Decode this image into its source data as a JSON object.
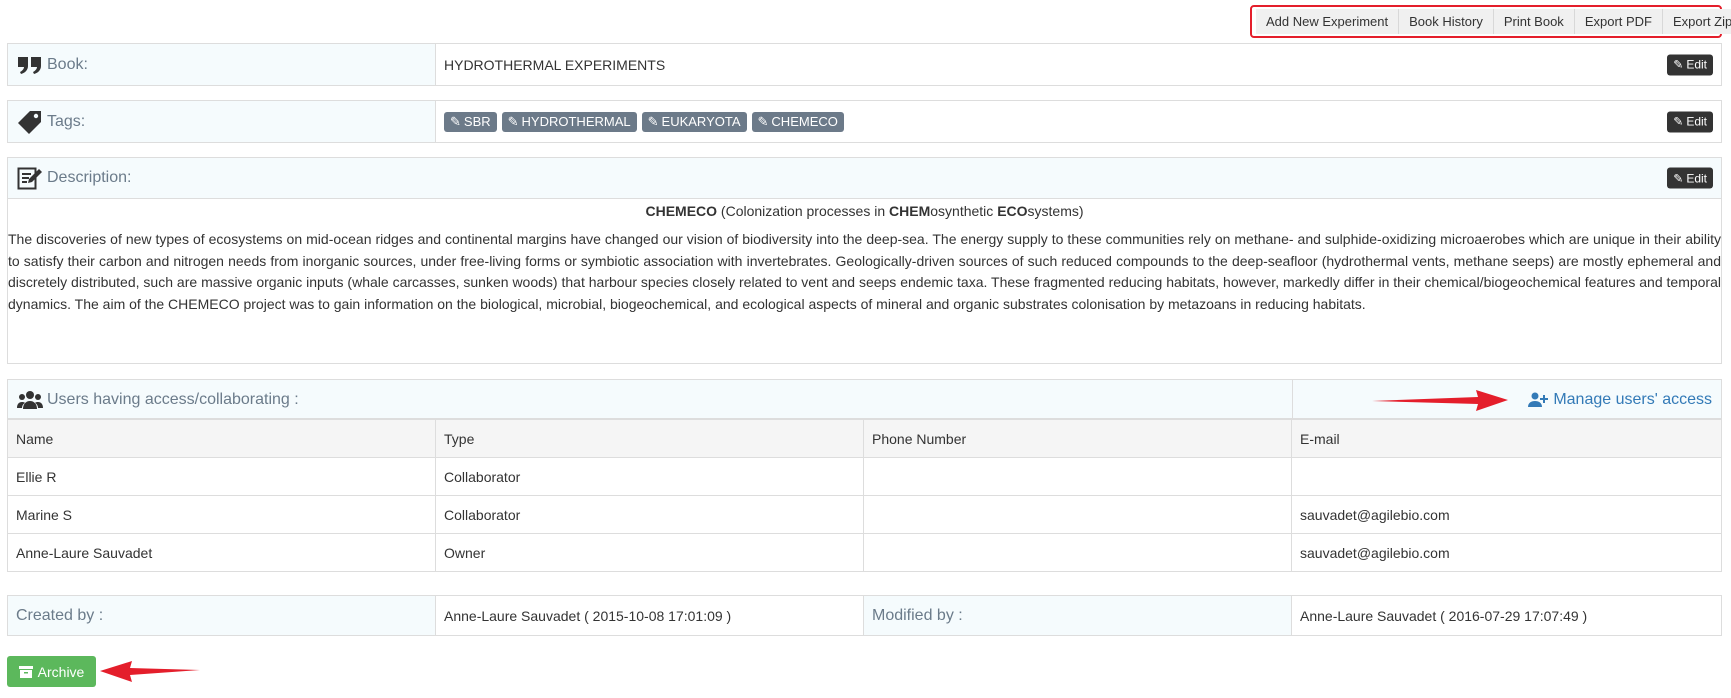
{
  "toolbar": {
    "buttons": [
      "Add New Experiment",
      "Book History",
      "Print Book",
      "Export PDF",
      "Export Zip"
    ]
  },
  "book": {
    "label": "Book:",
    "value": "HYDROTHERMAL EXPERIMENTS",
    "edit": "Edit"
  },
  "tags": {
    "label": "Tags:",
    "items": [
      "SBR",
      "HYDROTHERMAL",
      "EUKARYOTA",
      "CHEMECO"
    ],
    "edit": "Edit"
  },
  "description": {
    "label": "Description:",
    "edit": "Edit",
    "title_parts": [
      "CHEMECO",
      " (Colonization processes in ",
      "CHEM",
      "osynthetic ",
      "ECO",
      "systems)"
    ],
    "text": "The discoveries of new types of ecosystems on mid-ocean ridges and continental margins have changed our vision of biodiversity into the deep-sea. The energy supply to these communities rely on methane- and sulphide-oxidizing microaerobes which are unique in their ability to satisfy their carbon and nitrogen needs from inorganic sources, under free-living forms or symbiotic association with invertebrates. Geologically-driven sources of such reduced compounds to the deep-seafloor (hydrothermal vents, methane seeps) are mostly ephemeral and discretely distributed, such are massive organic inputs (whale carcasses, sunken woods) that harbour species closely related to vent and seeps endemic taxa. These fragmented reducing habitats, however, markedly differ in their chemical/biogeochemical features and temporal dynamics. The aim of the CHEMECO project was to gain information on the biological, microbial, biogeochemical, and ecological aspects of mineral and organic substrates colonisation by metazoans in reducing habitats."
  },
  "users": {
    "label": "Users having access/collaborating :",
    "manage": "Manage users' access",
    "columns": [
      "Name",
      "Type",
      "Phone Number",
      "E-mail"
    ],
    "rows": [
      [
        "Ellie R",
        "Collaborator",
        "",
        ""
      ],
      [
        "Marine S",
        "Collaborator",
        "",
        "sauvadet@agilebio.com"
      ],
      [
        "Anne-Laure Sauvadet",
        "Owner",
        "",
        "sauvadet@agilebio.com"
      ]
    ]
  },
  "meta": {
    "created_label": "Created by :",
    "created_value": "Anne-Laure Sauvadet ( 2015-10-08 17:01:09 )",
    "modified_label": "Modified by :",
    "modified_value": "Anne-Laure Sauvadet ( 2016-07-29 17:07:49 )"
  },
  "archive": {
    "label": "Archive"
  },
  "colors": {
    "accent_red": "#e41e2b",
    "archive_green": "#5cb85c",
    "link_blue": "#337ab7",
    "tag_gray": "#6c7a89"
  }
}
